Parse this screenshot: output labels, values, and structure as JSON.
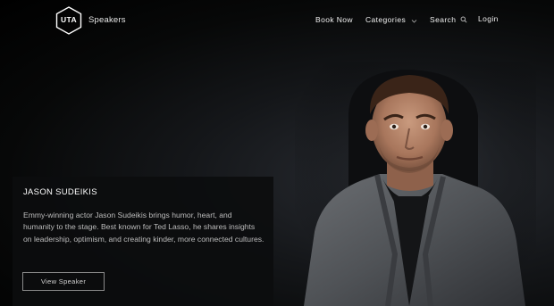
{
  "header": {
    "logo_text": "UTA",
    "brand": "Speakers",
    "nav": {
      "book_now": "Book Now",
      "categories": "Categories",
      "search": "Search",
      "login": "Login"
    }
  },
  "speaker": {
    "name": "JASON SUDEIKIS",
    "description": "Emmy-winning actor Jason Sudeikis brings humor, heart, and humanity to the stage. Best known for Ted Lasso, he shares insights on leadership, optimism, and creating kinder, more connected cultures.",
    "button_label": "View Speaker"
  },
  "icons": {
    "categories": "chevron-down-icon",
    "search": "search-icon"
  },
  "colors": {
    "background": "#000000",
    "text": "#ffffff",
    "muted_text": "#bdbdbd",
    "button_border": "#8a8a8a"
  }
}
